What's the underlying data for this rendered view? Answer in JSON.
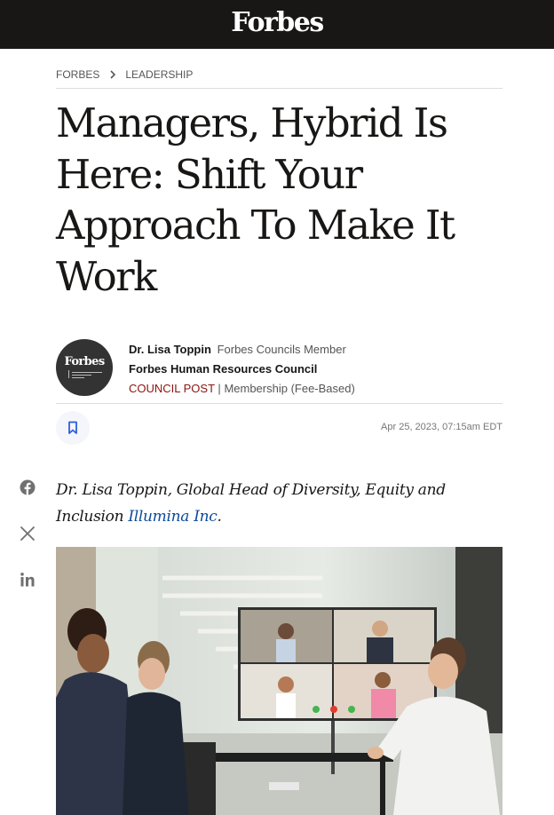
{
  "header": {
    "logo": "Forbes"
  },
  "breadcrumb": {
    "items": [
      "FORBES",
      "LEADERSHIP"
    ]
  },
  "article": {
    "title": "Managers, Hybrid Is Here: Shift Your Approach To Make It Work",
    "byline": {
      "author": "Dr. Lisa Toppin",
      "role": "Forbes Councils Member",
      "council": "Forbes Human Resources Council",
      "post_type": "COUNCIL POST",
      "separator": "|",
      "membership": "Membership (Fee-Based)",
      "avatar_logo": "Forbes"
    },
    "date": "Apr 25, 2023, 07:15am EDT",
    "lede": {
      "text": "Dr. Lisa Toppin, Global Head of Diversity, Equity and Inclusion ",
      "link": "Illumina Inc",
      "end": "."
    }
  },
  "share": {
    "icons": [
      "facebook-icon",
      "x-icon",
      "linkedin-icon"
    ]
  },
  "colors": {
    "header_bg": "#181716",
    "post_type": "#8b1410",
    "link": "#0b4a9c"
  }
}
